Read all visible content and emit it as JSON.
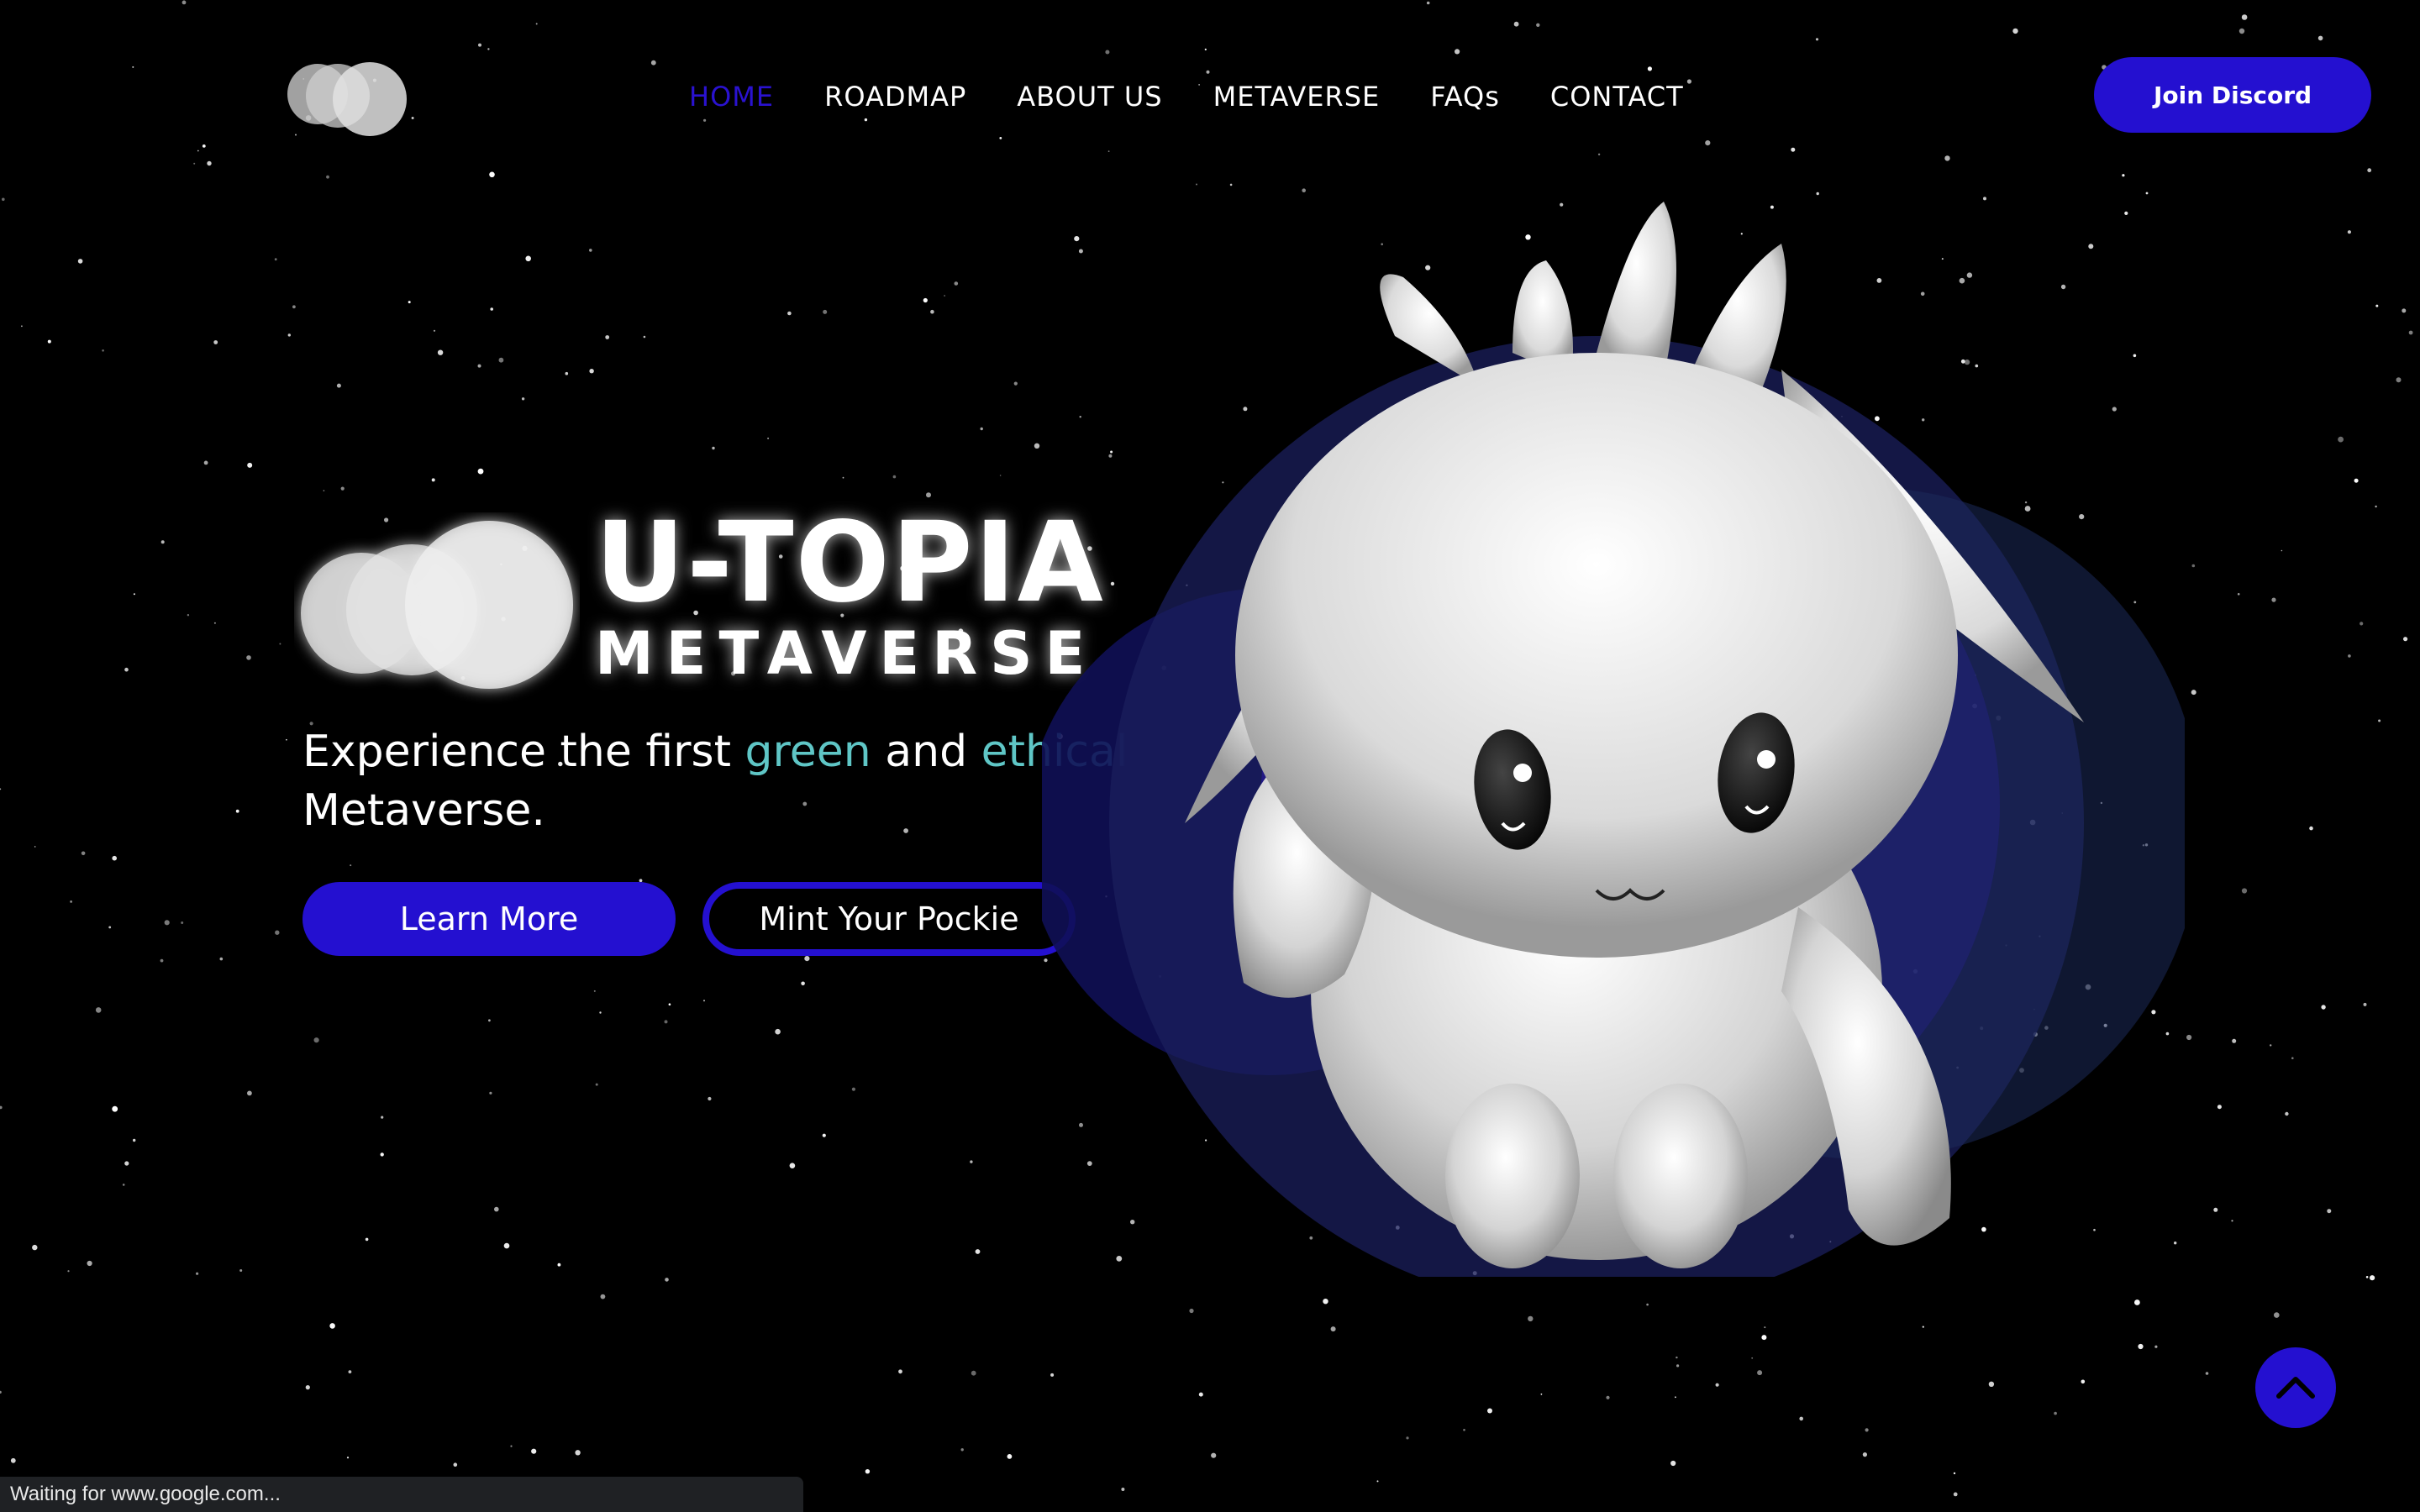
{
  "nav": {
    "items": [
      {
        "label": "HOME",
        "active": true
      },
      {
        "label": "ROADMAP",
        "active": false
      },
      {
        "label": "ABOUT US",
        "active": false
      },
      {
        "label": "METAVERSE",
        "active": false
      },
      {
        "label": "FAQs",
        "active": false
      },
      {
        "label": "CONTACT",
        "active": false
      }
    ],
    "cta_label": "Join Discord"
  },
  "hero": {
    "title": "U-TOPIA",
    "subtitle": "METAVERSE",
    "tagline_parts": {
      "p1": "Experience the first ",
      "green": "green",
      "p2": " and ",
      "ethical": "ethical",
      "p3": "Metaverse."
    },
    "learn_more_label": "Learn More",
    "mint_label": "Mint Your Pockie"
  },
  "icons": {
    "logo": "three-circles-logo",
    "scroll_top": "chevron-up-icon",
    "mascot": "white-creature-mascot"
  },
  "colors": {
    "accent": "#2410d0",
    "highlight": "#5fc6c6",
    "background": "#000000"
  },
  "browser_status": "Waiting for www.google.com..."
}
